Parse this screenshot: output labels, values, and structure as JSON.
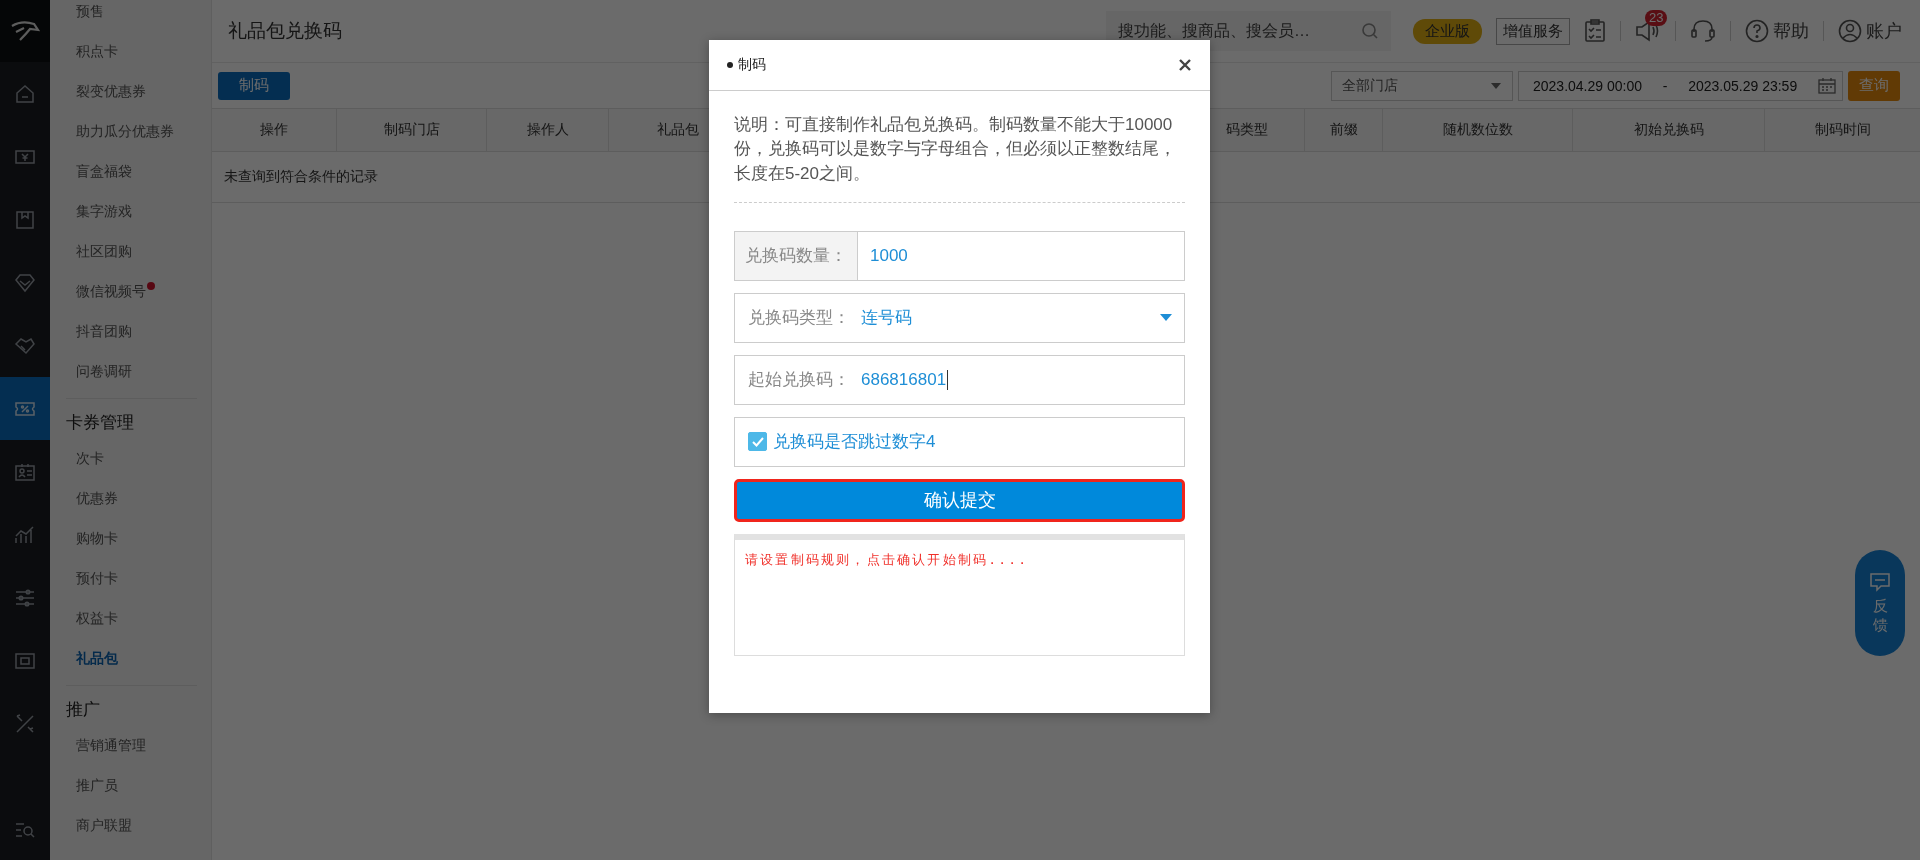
{
  "nav_rail": [
    {
      "selected": false
    },
    {
      "selected": false
    },
    {
      "selected": false
    },
    {
      "selected": false
    },
    {
      "selected": false
    },
    {
      "selected": true
    },
    {
      "selected": false
    },
    {
      "selected": false
    },
    {
      "selected": false
    },
    {
      "selected": false
    },
    {
      "selected": false
    }
  ],
  "submenu": [
    {
      "items": [
        {
          "label": "预售",
          "selected": false,
          "dot": false
        },
        {
          "label": "积点卡",
          "selected": false,
          "dot": false
        },
        {
          "label": "裂变优惠券",
          "selected": false,
          "dot": false
        },
        {
          "label": "助力瓜分优惠券",
          "selected": false,
          "dot": false
        },
        {
          "label": "盲盒福袋",
          "selected": false,
          "dot": false
        },
        {
          "label": "集字游戏",
          "selected": false,
          "dot": false
        },
        {
          "label": "社区团购",
          "selected": false,
          "dot": false
        },
        {
          "label": "微信视频号",
          "selected": false,
          "dot": true
        },
        {
          "label": "抖音团购",
          "selected": false,
          "dot": false
        },
        {
          "label": "问卷调研",
          "selected": false,
          "dot": false
        }
      ]
    },
    {
      "heading": "卡券管理",
      "items": [
        {
          "label": "次卡",
          "selected": false,
          "dot": false
        },
        {
          "label": "优惠券",
          "selected": false,
          "dot": false
        },
        {
          "label": "购物卡",
          "selected": false,
          "dot": false
        },
        {
          "label": "预付卡",
          "selected": false,
          "dot": false
        },
        {
          "label": "权益卡",
          "selected": false,
          "dot": false
        },
        {
          "label": "礼品包",
          "selected": true,
          "dot": false
        }
      ]
    },
    {
      "heading": "推广",
      "items": [
        {
          "label": "营销通管理",
          "selected": false,
          "dot": false
        },
        {
          "label": "推广员",
          "selected": false,
          "dot": false
        },
        {
          "label": "商户联盟",
          "selected": false,
          "dot": false
        }
      ]
    }
  ],
  "header": {
    "title": "礼品包兑换码",
    "search": {
      "placeholder": "搜功能、搜商品、搜会员…"
    },
    "edition_badge": "企业版",
    "value_added_button": "增值服务",
    "notification_count": "23",
    "help": "帮助",
    "account": "账户"
  },
  "toolbar": {
    "create_button": "制码",
    "store_select": "全部门店",
    "date_start": "2023.04.29 00:00",
    "date_separator": "-",
    "date_end": "2023.05.29 23:59",
    "query_button": "查询"
  },
  "table": {
    "columns": [
      "操作",
      "制码门店",
      "操作人",
      "礼品包",
      "码类型",
      "前缀",
      "随机数位数",
      "初始兑换码",
      "制码时间"
    ],
    "empty_message": "未查询到符合条件的记录"
  },
  "modal": {
    "title": "制码",
    "description": "说明：可直接制作礼品包兑换码。制码数量不能大于10000份，兑换码可以是数字与字母组合，但必须以正整数结尾，长度在5-20之间。",
    "fields": [
      {
        "kind": "addon",
        "label": "兑换码数量：",
        "value": "1000"
      },
      {
        "kind": "select",
        "label": "兑换码类型：",
        "value": "连号码"
      },
      {
        "kind": "input",
        "label": "起始兑换码：",
        "value": "686816801"
      }
    ],
    "skip_four": {
      "label": "兑换码是否跳过数字4",
      "checked": true
    },
    "submit_button": "确认提交",
    "log": "请设置制码规则，点击确认开始制码...."
  },
  "feedback_button": "反馈"
}
